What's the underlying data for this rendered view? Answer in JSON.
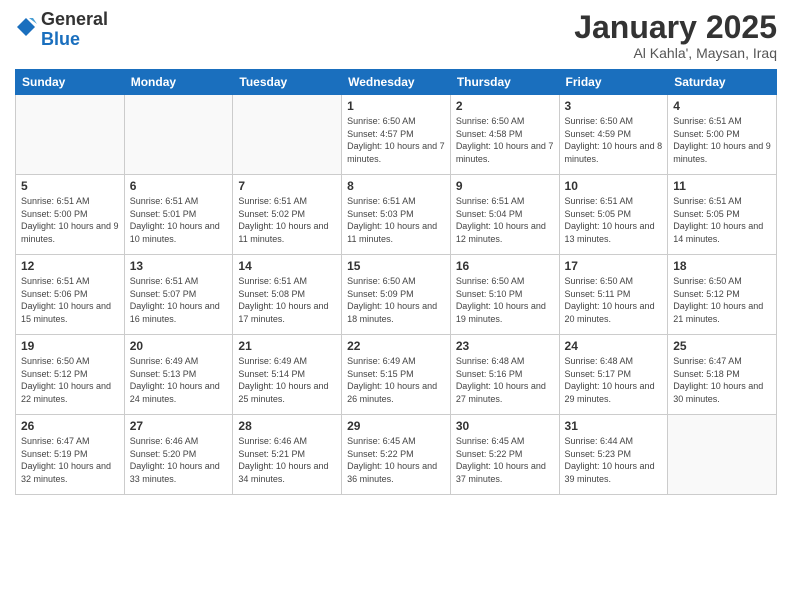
{
  "logo": {
    "general": "General",
    "blue": "Blue"
  },
  "header": {
    "title": "January 2025",
    "subtitle": "Al Kahla', Maysan, Iraq"
  },
  "weekdays": [
    "Sunday",
    "Monday",
    "Tuesday",
    "Wednesday",
    "Thursday",
    "Friday",
    "Saturday"
  ],
  "weeks": [
    [
      {
        "day": "",
        "info": ""
      },
      {
        "day": "",
        "info": ""
      },
      {
        "day": "",
        "info": ""
      },
      {
        "day": "1",
        "info": "Sunrise: 6:50 AM\nSunset: 4:57 PM\nDaylight: 10 hours\nand 7 minutes."
      },
      {
        "day": "2",
        "info": "Sunrise: 6:50 AM\nSunset: 4:58 PM\nDaylight: 10 hours\nand 7 minutes."
      },
      {
        "day": "3",
        "info": "Sunrise: 6:50 AM\nSunset: 4:59 PM\nDaylight: 10 hours\nand 8 minutes."
      },
      {
        "day": "4",
        "info": "Sunrise: 6:51 AM\nSunset: 5:00 PM\nDaylight: 10 hours\nand 9 minutes."
      }
    ],
    [
      {
        "day": "5",
        "info": "Sunrise: 6:51 AM\nSunset: 5:00 PM\nDaylight: 10 hours\nand 9 minutes."
      },
      {
        "day": "6",
        "info": "Sunrise: 6:51 AM\nSunset: 5:01 PM\nDaylight: 10 hours\nand 10 minutes."
      },
      {
        "day": "7",
        "info": "Sunrise: 6:51 AM\nSunset: 5:02 PM\nDaylight: 10 hours\nand 11 minutes."
      },
      {
        "day": "8",
        "info": "Sunrise: 6:51 AM\nSunset: 5:03 PM\nDaylight: 10 hours\nand 11 minutes."
      },
      {
        "day": "9",
        "info": "Sunrise: 6:51 AM\nSunset: 5:04 PM\nDaylight: 10 hours\nand 12 minutes."
      },
      {
        "day": "10",
        "info": "Sunrise: 6:51 AM\nSunset: 5:05 PM\nDaylight: 10 hours\nand 13 minutes."
      },
      {
        "day": "11",
        "info": "Sunrise: 6:51 AM\nSunset: 5:05 PM\nDaylight: 10 hours\nand 14 minutes."
      }
    ],
    [
      {
        "day": "12",
        "info": "Sunrise: 6:51 AM\nSunset: 5:06 PM\nDaylight: 10 hours\nand 15 minutes."
      },
      {
        "day": "13",
        "info": "Sunrise: 6:51 AM\nSunset: 5:07 PM\nDaylight: 10 hours\nand 16 minutes."
      },
      {
        "day": "14",
        "info": "Sunrise: 6:51 AM\nSunset: 5:08 PM\nDaylight: 10 hours\nand 17 minutes."
      },
      {
        "day": "15",
        "info": "Sunrise: 6:50 AM\nSunset: 5:09 PM\nDaylight: 10 hours\nand 18 minutes."
      },
      {
        "day": "16",
        "info": "Sunrise: 6:50 AM\nSunset: 5:10 PM\nDaylight: 10 hours\nand 19 minutes."
      },
      {
        "day": "17",
        "info": "Sunrise: 6:50 AM\nSunset: 5:11 PM\nDaylight: 10 hours\nand 20 minutes."
      },
      {
        "day": "18",
        "info": "Sunrise: 6:50 AM\nSunset: 5:12 PM\nDaylight: 10 hours\nand 21 minutes."
      }
    ],
    [
      {
        "day": "19",
        "info": "Sunrise: 6:50 AM\nSunset: 5:12 PM\nDaylight: 10 hours\nand 22 minutes."
      },
      {
        "day": "20",
        "info": "Sunrise: 6:49 AM\nSunset: 5:13 PM\nDaylight: 10 hours\nand 24 minutes."
      },
      {
        "day": "21",
        "info": "Sunrise: 6:49 AM\nSunset: 5:14 PM\nDaylight: 10 hours\nand 25 minutes."
      },
      {
        "day": "22",
        "info": "Sunrise: 6:49 AM\nSunset: 5:15 PM\nDaylight: 10 hours\nand 26 minutes."
      },
      {
        "day": "23",
        "info": "Sunrise: 6:48 AM\nSunset: 5:16 PM\nDaylight: 10 hours\nand 27 minutes."
      },
      {
        "day": "24",
        "info": "Sunrise: 6:48 AM\nSunset: 5:17 PM\nDaylight: 10 hours\nand 29 minutes."
      },
      {
        "day": "25",
        "info": "Sunrise: 6:47 AM\nSunset: 5:18 PM\nDaylight: 10 hours\nand 30 minutes."
      }
    ],
    [
      {
        "day": "26",
        "info": "Sunrise: 6:47 AM\nSunset: 5:19 PM\nDaylight: 10 hours\nand 32 minutes."
      },
      {
        "day": "27",
        "info": "Sunrise: 6:46 AM\nSunset: 5:20 PM\nDaylight: 10 hours\nand 33 minutes."
      },
      {
        "day": "28",
        "info": "Sunrise: 6:46 AM\nSunset: 5:21 PM\nDaylight: 10 hours\nand 34 minutes."
      },
      {
        "day": "29",
        "info": "Sunrise: 6:45 AM\nSunset: 5:22 PM\nDaylight: 10 hours\nand 36 minutes."
      },
      {
        "day": "30",
        "info": "Sunrise: 6:45 AM\nSunset: 5:22 PM\nDaylight: 10 hours\nand 37 minutes."
      },
      {
        "day": "31",
        "info": "Sunrise: 6:44 AM\nSunset: 5:23 PM\nDaylight: 10 hours\nand 39 minutes."
      },
      {
        "day": "",
        "info": ""
      }
    ]
  ]
}
